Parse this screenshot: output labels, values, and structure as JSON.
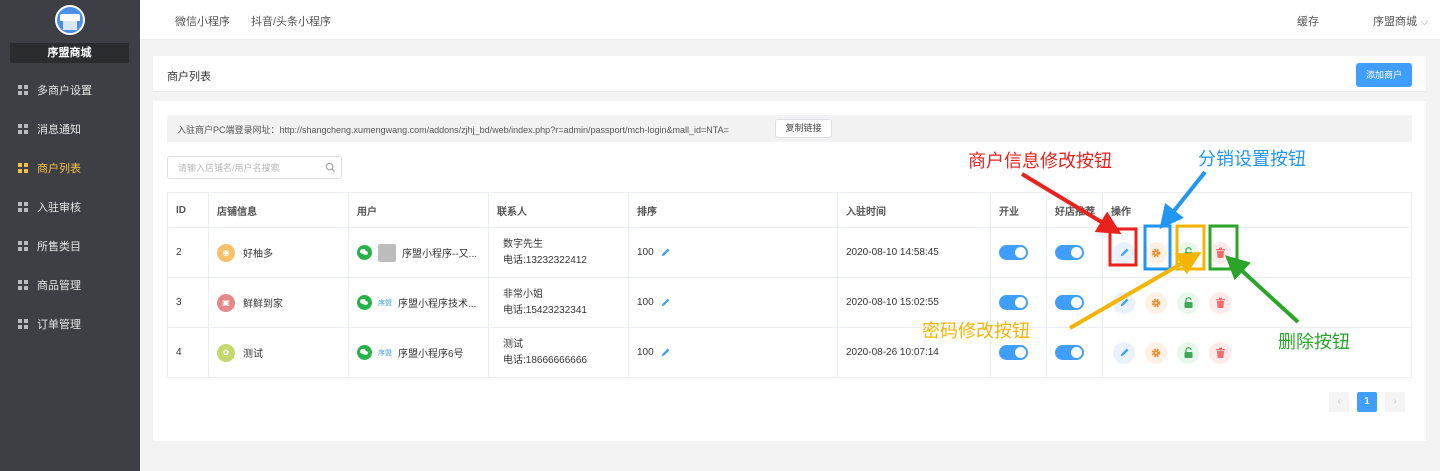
{
  "sidebar": {
    "shop_name": "序盟商城",
    "items": [
      {
        "label": "多商户设置",
        "active": false
      },
      {
        "label": "消息通知",
        "active": false
      },
      {
        "label": "商户列表",
        "active": true
      },
      {
        "label": "入驻审核",
        "active": false
      },
      {
        "label": "所售类目",
        "active": false
      },
      {
        "label": "商品管理",
        "active": false
      },
      {
        "label": "订单管理",
        "active": false
      }
    ]
  },
  "topbar": {
    "tabs": [
      "微信小程序",
      "抖音/头条小程序"
    ],
    "cache": "缓存",
    "user": "序盟商城",
    "user_arrow": "⌵"
  },
  "header": {
    "title": "商户列表",
    "add_button": "添加商户"
  },
  "login_url": {
    "text": "入驻商户PC端登录网址：http://shangcheng.xumengwang.com/addons/zjhj_bd/web/index.php?r=admin/passport/mch-login&mall_id=NTA=",
    "copy_button": "复制链接"
  },
  "search": {
    "placeholder": "请输入店铺名/用户名搜索"
  },
  "table": {
    "headers": [
      "ID",
      "店铺信息",
      "用户",
      "联系人",
      "排序",
      "入驻时间",
      "开业",
      "好店推荐",
      "操作"
    ],
    "rows": [
      {
        "id": "2",
        "store": "好柚多",
        "logo_color": "#f5c26b",
        "user": "序盟小程序--又...",
        "user_badge": "",
        "contact": "数字先生",
        "phone": "电话:13232322412",
        "sort": "100",
        "time": "2020-08-10 14:58:45",
        "open": true,
        "recommend": true
      },
      {
        "id": "3",
        "store": "鲜鲜到家",
        "logo_color": "#e58a8a",
        "user": "序盟小程序技术...",
        "user_badge": "序盟",
        "contact": "非常小姐",
        "phone": "电话:15423232341",
        "sort": "100",
        "time": "2020-08-10 15:02:55",
        "open": true,
        "recommend": true
      },
      {
        "id": "4",
        "store": "测试",
        "logo_color": "#c5d86d",
        "user": "序盟小程序6号",
        "user_badge": "序盟",
        "contact": "测试",
        "phone": "电话:18666666666",
        "sort": "100",
        "time": "2020-08-26 10:07:14",
        "open": true,
        "recommend": true
      }
    ]
  },
  "pagination": {
    "prev": "‹",
    "current": "1",
    "next": "›"
  },
  "annotations": {
    "edit_info": {
      "text": "商户信息修改按钮",
      "color": "#e8221c"
    },
    "distribution": {
      "text": "分销设置按钮",
      "color": "#2196f3"
    },
    "password": {
      "text": "密码修改按钮",
      "color": "#f5b400"
    },
    "delete": {
      "text": "删除按钮",
      "color": "#2aa52a"
    }
  },
  "colors": {
    "accent": "#409eff",
    "sidebar_bg": "#3d3f44",
    "active_nav": "#f6c244"
  }
}
